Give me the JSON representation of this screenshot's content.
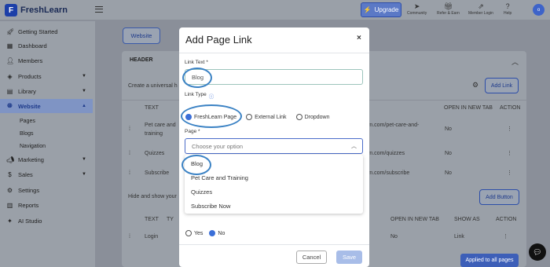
{
  "app": {
    "logo_text": "FreshLearn",
    "upgrade_label": "Upgrade",
    "avatar_initial": "o",
    "top_icons": [
      {
        "label": "Community",
        "icon": "community-icon"
      },
      {
        "label": "Refer & Earn",
        "icon": "gift-icon"
      },
      {
        "label": "Member Login",
        "icon": "external-link-icon"
      },
      {
        "label": "Help",
        "icon": "help-icon"
      }
    ]
  },
  "sidebar": {
    "items": [
      {
        "label": "Getting Started",
        "icon": "rocket-icon"
      },
      {
        "label": "Dashboard",
        "icon": "dashboard-icon"
      },
      {
        "label": "Members",
        "icon": "members-icon"
      },
      {
        "label": "Products",
        "icon": "products-icon"
      },
      {
        "label": "Library",
        "icon": "library-icon"
      },
      {
        "label": "Website",
        "icon": "globe-icon"
      },
      {
        "label": "Marketing",
        "icon": "megaphone-icon"
      },
      {
        "label": "Sales",
        "icon": "dollar-icon"
      },
      {
        "label": "Settings",
        "icon": "gear-icon"
      },
      {
        "label": "Reports",
        "icon": "reports-icon"
      },
      {
        "label": "AI Studio",
        "icon": "ai-icon"
      }
    ],
    "subitems": [
      "Pages",
      "Blogs",
      "Navigation"
    ]
  },
  "background": {
    "tab_label": "Website",
    "header_title": "HEADER",
    "header_desc": "Create a universal h",
    "add_link_label": "Add Link",
    "col_text": "TEXT",
    "col_open_new_tab": "OPEN IN NEW TAB",
    "col_action": "ACTION",
    "rows": [
      {
        "text1": "Pet care and",
        "text2": "training",
        "url": "rn.com/pet-care-and-",
        "new_tab": "No"
      },
      {
        "text1": "Quizzes",
        "text2": "",
        "url": "rn.com/quizzes",
        "new_tab": "No"
      },
      {
        "text1": "Subscribe",
        "text2": "",
        "url": "rn.com/subscribe",
        "new_tab": "No"
      }
    ],
    "footer_desc": "Hide and show your",
    "add_button_label": "Add Button",
    "col_text_2": "TEXT",
    "col_ty": "TY",
    "col_show_as": "SHOW AS",
    "footer_row": {
      "text": "Login",
      "new_tab": "No",
      "show_as": "Link"
    },
    "applied_label": "Applied to all pages"
  },
  "modal": {
    "title": "Add Page Link",
    "close_glyph": "×",
    "link_text_label": "Link Text *",
    "link_text_value": "Blog",
    "link_type_label": "Link Type",
    "link_types": [
      "FreshLearn Page",
      "External Link",
      "Dropdown"
    ],
    "selected_link_type": "FreshLearn Page",
    "page_label": "Page *",
    "page_placeholder": "Choose your option",
    "page_options": [
      "Blog",
      "Pet Care and Training",
      "Quizzes",
      "Subscribe Now"
    ],
    "yes_label": "Yes",
    "no_label": "No",
    "cancel_label": "Cancel",
    "save_label": "Save"
  },
  "colors": {
    "accent": "#3b6fd8",
    "highlight_ring": "#3b82c4",
    "brand": "#1c3fa8"
  }
}
